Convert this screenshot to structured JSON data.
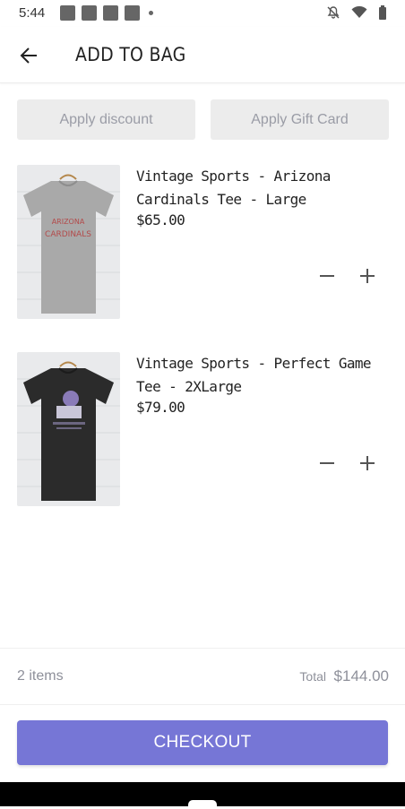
{
  "status_bar": {
    "time": "5:44"
  },
  "header": {
    "title": "ADD TO BAG"
  },
  "actions": {
    "discount_label": "Apply discount",
    "gift_label": "Apply Gift Card"
  },
  "items": [
    {
      "name": "Vintage Sports - Arizona Cardinals Tee - Large",
      "price": "$65.00",
      "shirt_color": "#a9a9a9"
    },
    {
      "name": "Vintage Sports - Perfect Game Tee - 2XLarge",
      "price": "$79.00",
      "shirt_color": "#2b2b2b"
    }
  ],
  "summary": {
    "count": "2 items",
    "total_label": "Total",
    "total_value": "$144.00"
  },
  "checkout": {
    "label": "CHECKOUT"
  },
  "colors": {
    "accent": "#7676d6",
    "button_bg": "#ececec",
    "muted_text": "#8e909a"
  }
}
